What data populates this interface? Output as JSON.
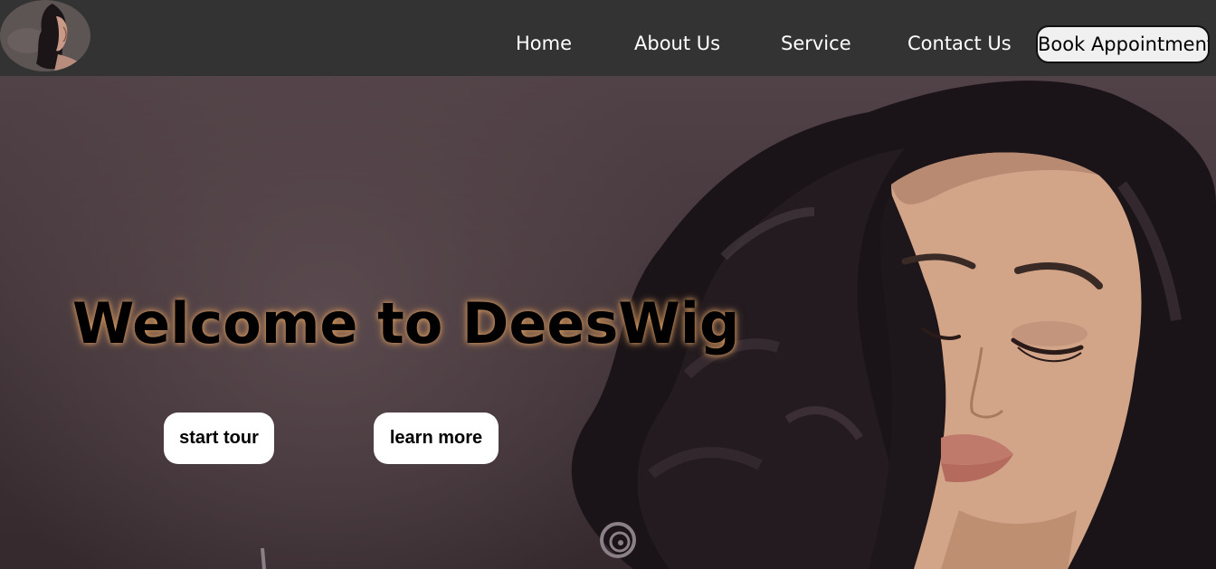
{
  "header": {
    "logo": {
      "icon": "salon-logo-icon"
    },
    "nav": {
      "home": "Home",
      "about": "About Us",
      "service": "Service",
      "contact": "Contact Us"
    },
    "book_button": "Book Appointment"
  },
  "hero": {
    "image": "woman-curly-hair-portrait",
    "title": "Welcome to DeesWig",
    "buttons": {
      "start_tour": "start tour",
      "learn_more": "learn more"
    }
  },
  "colors": {
    "navbar": "#333333",
    "hero_background": "#4a3c3f",
    "button_background": "#ffffff",
    "title_glow": "#d49a62"
  }
}
